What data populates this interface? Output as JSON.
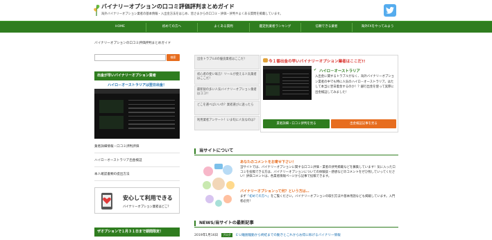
{
  "header": {
    "site_title": "バイナリーオプションの口コミ評価評判まとめガイド",
    "site_description": "海外バイナリーオプション業者の基本情報・入出金方法をはじめ、皆さまからの口コミ・評価・評判やよくある質問を掲載しています。"
  },
  "nav": {
    "items": [
      "HOME",
      "初めての方へ",
      "よくある質問",
      "鑑定別業者ランキング",
      "信頼できる業者",
      "海外FXをやってみよう"
    ]
  },
  "breadcrumb": "バイナリーオプションの口コミ評価評判まとめガイド",
  "sidebar": {
    "search_placeholder": "",
    "search_button": "検索",
    "section1_title": "出金が早いバイナリーオプション業者",
    "featured_caption": "ハイロ－オーストラリアは翌日出金！",
    "links": [
      "業者詳細情報・口コミ評判評価",
      "ハイロ－オーストラリア出金検証",
      "本人確認書類の提出方法"
    ],
    "banner_title": "安心して利用できる",
    "banner_subtitle": "バイナリーオプション業者はどこ？",
    "section2_title": "ザオプションで１月３１日まで期間限定！"
  },
  "features": {
    "items": [
      "出金トラブル0の優良業者はここだ！",
      "初心者の使い味方！ツールが使える人気業者はここだ！",
      "最新鋭の多い人気バイナリーオプション業者はココ!!",
      "どこを選べばいいの？業者選びに迷ったら",
      "利用業者アンケート！いま旬に人気なのは？"
    ],
    "panel_title": "今１番出金の早いバイナリーオプション業者はここだ!!",
    "panel_brand": "ハイロ－オーストラリア",
    "panel_text": "入出金に関するトラブルがなく、海外バイナリーオプション業者の中でも特に人気のハイロ－オーストラリア。はたして本当に翌日着金するのか！？銀行出金を使って実際に出金検証してみました！",
    "btn_detail": "業者詳細・口コミ評判を見る",
    "btn_withdraw": "出金検証記事を見る"
  },
  "about": {
    "heading": "当サイトについて",
    "title1": "あなたのコメントをお寄せ下さい！",
    "text1": "当サイトでは、バイナリーオプションに関する口コミ評価・業者の評判掲載などを募集しています！気に入った口コミを投稿できる方は、バイナリーオプションについての体験談・感想などのコメントをぜひ残していってください！評価コメントは、各業者情報ページから記事で投稿できます。",
    "title2": "バイナリーオプションって何？という方は…",
    "text2_before": "まず",
    "text2_link": "「初めての方へ」",
    "text2_after": "をご覧ください。バイナリーオプションの取引方法や基本用語なども掲載しています。入門者必見！"
  },
  "news": {
    "heading": "NEWS/当サイトの最新記事",
    "items": [
      {
        "date": "2019年1月16日",
        "tag": "ブログ",
        "title": "ＥＵ離脱騒動から終結までの動きとこれからお得に稼げるバイナリー情報"
      }
    ]
  },
  "colors": {
    "brand_green": "#2f7d1f",
    "accent_orange": "#e76d1f",
    "twitter_blue": "#55acee",
    "headline_red": "#d9302a",
    "link_blue": "#1a6fb0"
  }
}
